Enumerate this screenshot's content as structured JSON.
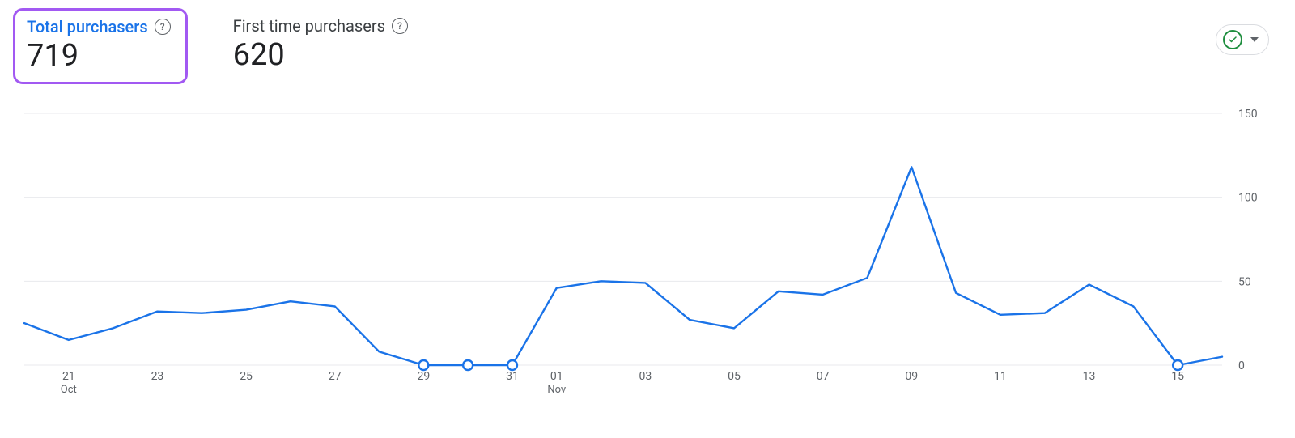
{
  "kpis": {
    "total": {
      "label": "Total purchasers",
      "value": "719"
    },
    "first": {
      "label": "First time purchasers",
      "value": "620"
    }
  },
  "chart_data": {
    "type": "line",
    "ylabel": "",
    "xlabel": "",
    "ylim": [
      0,
      150
    ],
    "y_ticks": [
      0,
      50,
      100,
      150
    ],
    "x_ticks": [
      {
        "i": 1,
        "label": "21",
        "sub": "Oct"
      },
      {
        "i": 3,
        "label": "23"
      },
      {
        "i": 5,
        "label": "25"
      },
      {
        "i": 7,
        "label": "27"
      },
      {
        "i": 9,
        "label": "29"
      },
      {
        "i": 11,
        "label": "31"
      },
      {
        "i": 12,
        "label": "01",
        "sub": "Nov"
      },
      {
        "i": 14,
        "label": "03"
      },
      {
        "i": 16,
        "label": "05"
      },
      {
        "i": 18,
        "label": "07"
      },
      {
        "i": 20,
        "label": "09"
      },
      {
        "i": 22,
        "label": "11"
      },
      {
        "i": 24,
        "label": "13"
      },
      {
        "i": 26,
        "label": "15"
      }
    ],
    "series": [
      {
        "name": "Total purchasers",
        "color": "#1a73e8",
        "dates": [
          "Oct 20",
          "Oct 21",
          "Oct 22",
          "Oct 23",
          "Oct 24",
          "Oct 25",
          "Oct 26",
          "Oct 27",
          "Oct 28",
          "Oct 29",
          "Oct 30",
          "Oct 31",
          "Nov 01",
          "Nov 02",
          "Nov 03",
          "Nov 04",
          "Nov 05",
          "Nov 06",
          "Nov 07",
          "Nov 08",
          "Nov 09",
          "Nov 10",
          "Nov 11",
          "Nov 12",
          "Nov 13",
          "Nov 14",
          "Nov 15",
          "Nov 16"
        ],
        "values": [
          25,
          15,
          22,
          32,
          31,
          33,
          38,
          35,
          8,
          0,
          0,
          0,
          46,
          50,
          49,
          27,
          22,
          44,
          42,
          52,
          118,
          43,
          30,
          31,
          48,
          35,
          0,
          5
        ]
      }
    ]
  }
}
